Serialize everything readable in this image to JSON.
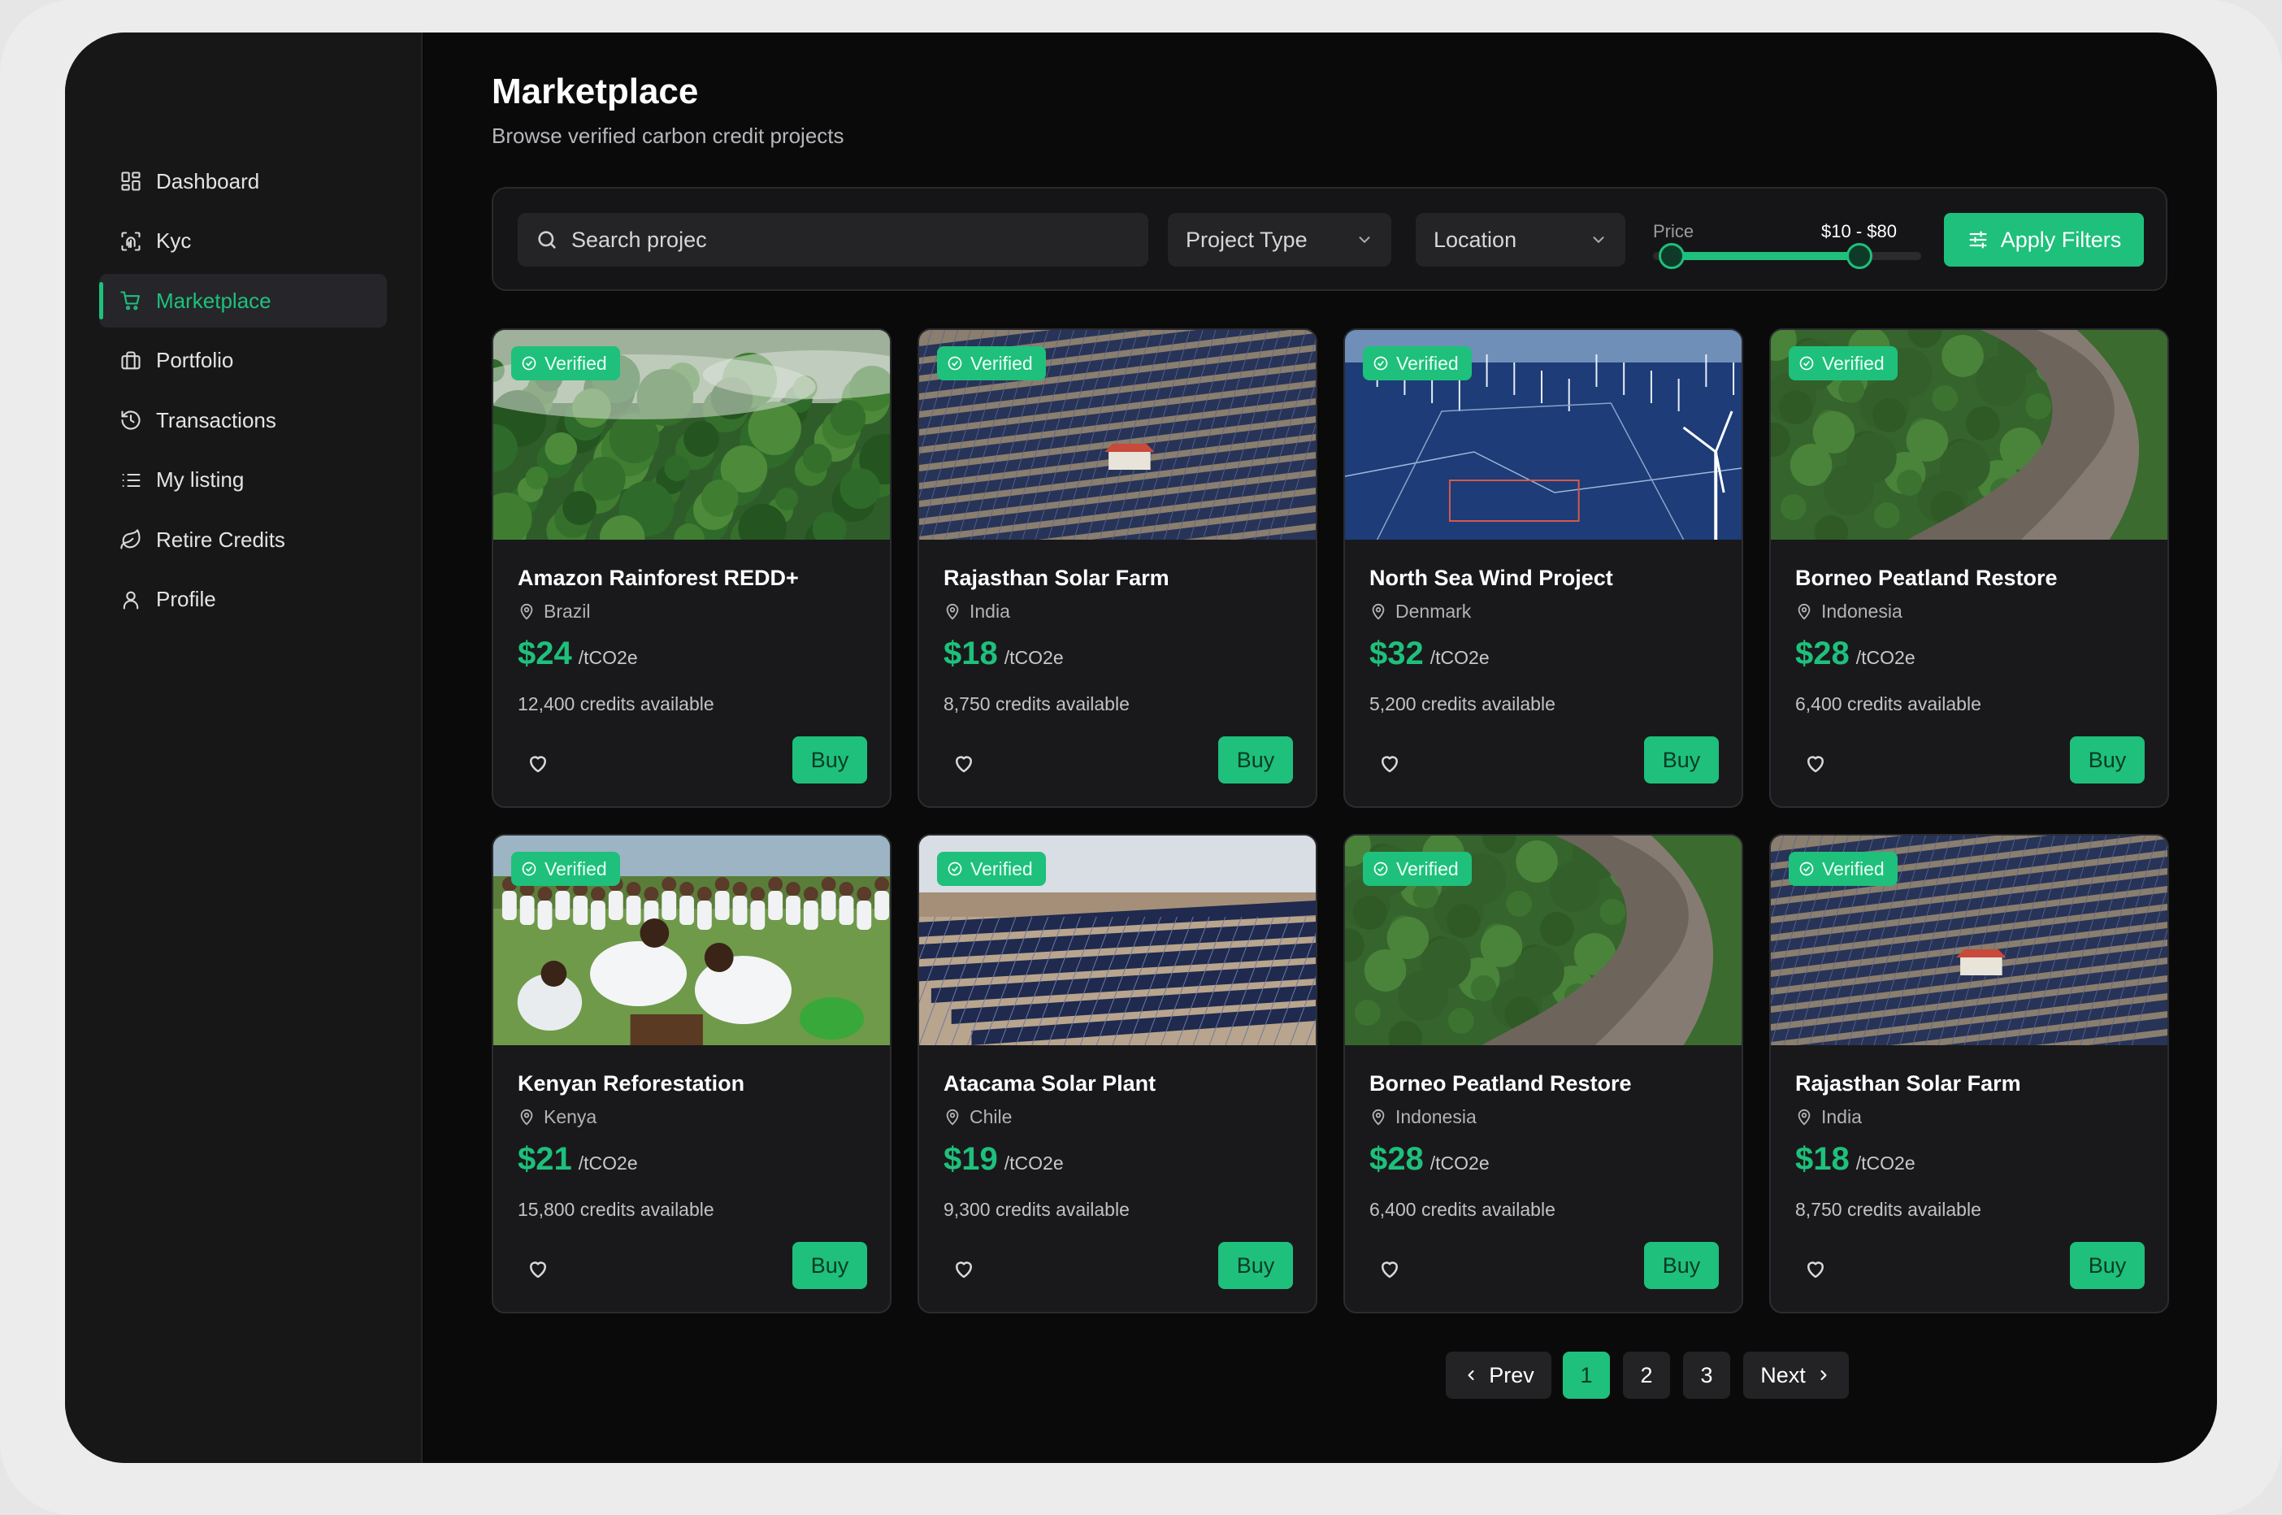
{
  "sidebar": {
    "items": [
      {
        "label": "Dashboard",
        "icon": "grid-icon"
      },
      {
        "label": "Kyc",
        "icon": "fingerprint-icon"
      },
      {
        "label": "Marketplace",
        "icon": "cart-icon",
        "active": true
      },
      {
        "label": "Portfolio",
        "icon": "briefcase-icon"
      },
      {
        "label": "Transactions",
        "icon": "history-icon"
      },
      {
        "label": "My listing",
        "icon": "list-icon"
      },
      {
        "label": "Retire Credits",
        "icon": "leaf-icon"
      },
      {
        "label": "Profile",
        "icon": "user-icon"
      }
    ]
  },
  "header": {
    "title": "Marketplace",
    "subtitle": "Browse verified carbon credit projects"
  },
  "filters": {
    "search_value": "Search projec",
    "project_type": "Project Type",
    "location": "Location",
    "price_label": "Price",
    "price_range": "$10 - $80",
    "price_min_fraction": 0.07,
    "price_max_fraction": 0.77,
    "apply_label": "Apply Filters"
  },
  "cards": [
    {
      "badge": "Verified",
      "title": "Amazon Rainforest REDD+",
      "location": "Brazil",
      "price": "$24",
      "unit": "/tCO2e",
      "available": "12,400 credits available",
      "buy": "Buy",
      "image": "rainforest"
    },
    {
      "badge": "Verified",
      "title": "Rajasthan Solar Farm",
      "location": "India",
      "price": "$18",
      "unit": "/tCO2e",
      "available": "8,750 credits available",
      "buy": "Buy",
      "image": "solar"
    },
    {
      "badge": "Verified",
      "title": "North Sea Wind Project",
      "location": "Denmark",
      "price": "$32",
      "unit": "/tCO2e",
      "available": "5,200 credits available",
      "buy": "Buy",
      "image": "wind"
    },
    {
      "badge": "Verified",
      "title": "Borneo Peatland Restore",
      "location": "Indonesia",
      "price": "$28",
      "unit": "/tCO2e",
      "available": "6,400 credits available",
      "buy": "Buy",
      "image": "river"
    },
    {
      "badge": "Verified",
      "title": "Kenyan Reforestation",
      "location": "Kenya",
      "price": "$21",
      "unit": "/tCO2e",
      "available": "15,800 credits available",
      "buy": "Buy",
      "image": "planting"
    },
    {
      "badge": "Verified",
      "title": "Atacama Solar Plant",
      "location": "Chile",
      "price": "$19",
      "unit": "/tCO2e",
      "available": "9,300 credits available",
      "buy": "Buy",
      "image": "solar-desert"
    },
    {
      "badge": "Verified",
      "title": "Borneo Peatland Restore",
      "location": "Indonesia",
      "price": "$28",
      "unit": "/tCO2e",
      "available": "6,400 credits available",
      "buy": "Buy",
      "image": "river"
    },
    {
      "badge": "Verified",
      "title": "Rajasthan Solar Farm",
      "location": "India",
      "price": "$18",
      "unit": "/tCO2e",
      "available": "8,750 credits available",
      "buy": "Buy",
      "image": "solar"
    }
  ],
  "pagination": {
    "prev": "Prev",
    "pages": [
      "1",
      "2",
      "3"
    ],
    "current": "1",
    "next": "Next"
  },
  "colors": {
    "accent": "#1ec07c",
    "background": "#0a0a0b",
    "sidebar": "#171718",
    "card": "#19191b"
  }
}
